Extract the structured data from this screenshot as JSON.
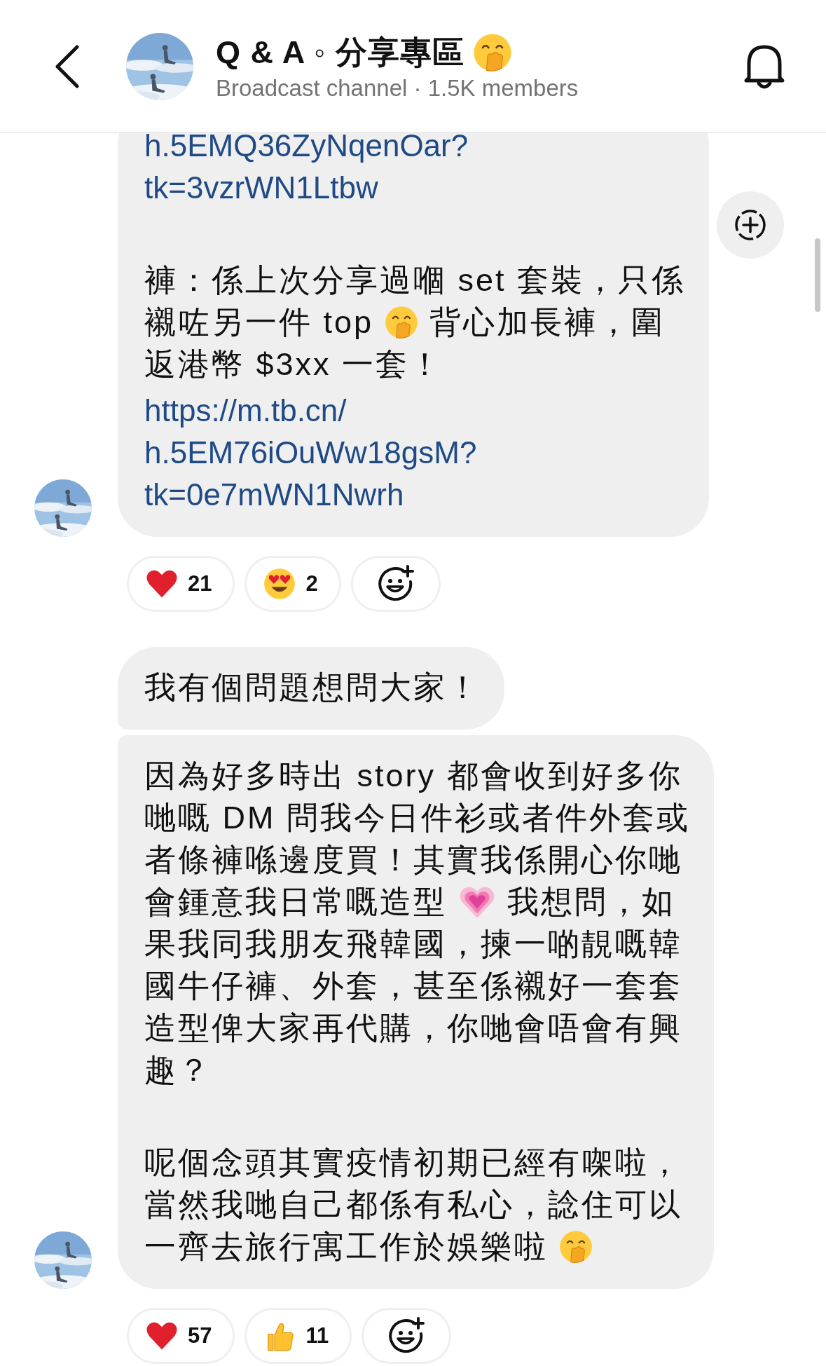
{
  "header": {
    "title": [
      {
        "kind": "text",
        "text": "Q & A ◦ 分享專區"
      },
      {
        "kind": "hand-smile"
      }
    ],
    "subtitle": "Broadcast channel · 1.5K members"
  },
  "groups": [
    {
      "bubbles": [
        {
          "blocks": [
            {
              "kind": "link",
              "lines": [
                "h.5EMQ36ZyNqenOar?",
                "tk=3vzrWN1Ltbw"
              ]
            },
            {
              "kind": "paragraph",
              "lines": [
                [
                  {
                    "kind": "text",
                    "text": "褲：係上次分享過嗰 set 套裝，只係"
                  }
                ],
                [
                  {
                    "kind": "text",
                    "text": "襯咗另一件 top"
                  },
                  {
                    "kind": "hand-smile"
                  },
                  {
                    "kind": "text",
                    "text": "背心加長褲，圍"
                  }
                ],
                [
                  {
                    "kind": "text",
                    "text": "返港幣 $3xx 一套！"
                  }
                ]
              ]
            },
            {
              "kind": "link",
              "lines": [
                "https://m.tb.cn/",
                "h.5EM76iOuWw18gsM?",
                "tk=0e7mWN1Nwrh"
              ]
            }
          ]
        }
      ],
      "reactions": [
        {
          "kind": "heart",
          "count": "21"
        },
        {
          "kind": "heart-eyes",
          "count": "2"
        }
      ]
    },
    {
      "bubbles": [
        {
          "blocks": [
            {
              "kind": "paragraph",
              "lines": [
                [
                  {
                    "kind": "text",
                    "text": "我有個問題想問大家！"
                  }
                ]
              ]
            }
          ]
        },
        {
          "blocks": [
            {
              "kind": "paragraph",
              "lines": [
                [
                  {
                    "kind": "text",
                    "text": "因為好多時出 story 都會收到好多你"
                  }
                ],
                [
                  {
                    "kind": "text",
                    "text": "哋嘅 DM 問我今日件衫或者件外套或"
                  }
                ],
                [
                  {
                    "kind": "text",
                    "text": "者條褲喺邊度買！其實我係開心你哋"
                  }
                ],
                [
                  {
                    "kind": "text",
                    "text": "會鍾意我日常嘅造型"
                  },
                  {
                    "kind": "pink-heart"
                  },
                  {
                    "kind": "text",
                    "text": "我想問，如"
                  }
                ],
                [
                  {
                    "kind": "text",
                    "text": "果我同我朋友飛韓國，揀一啲靚嘅韓"
                  }
                ],
                [
                  {
                    "kind": "text",
                    "text": "國牛仔褲、外套，甚至係襯好一套套"
                  }
                ],
                [
                  {
                    "kind": "text",
                    "text": "造型俾大家再代購，你哋會唔會有興"
                  }
                ],
                [
                  {
                    "kind": "text",
                    "text": "趣？"
                  }
                ]
              ]
            },
            {
              "kind": "paragraph",
              "lines": [
                [
                  {
                    "kind": "text",
                    "text": "呢個念頭其實疫情初期已經有㗎啦，"
                  }
                ],
                [
                  {
                    "kind": "text",
                    "text": "當然我哋自己都係有私心，諗住可以"
                  }
                ],
                [
                  {
                    "kind": "text",
                    "text": "一齊去旅行寓工作於娛樂啦"
                  },
                  {
                    "kind": "hand-smile"
                  }
                ]
              ]
            }
          ]
        }
      ],
      "reactions": [
        {
          "kind": "heart",
          "count": "57"
        },
        {
          "kind": "thumbs-up",
          "count": "11"
        }
      ]
    }
  ]
}
